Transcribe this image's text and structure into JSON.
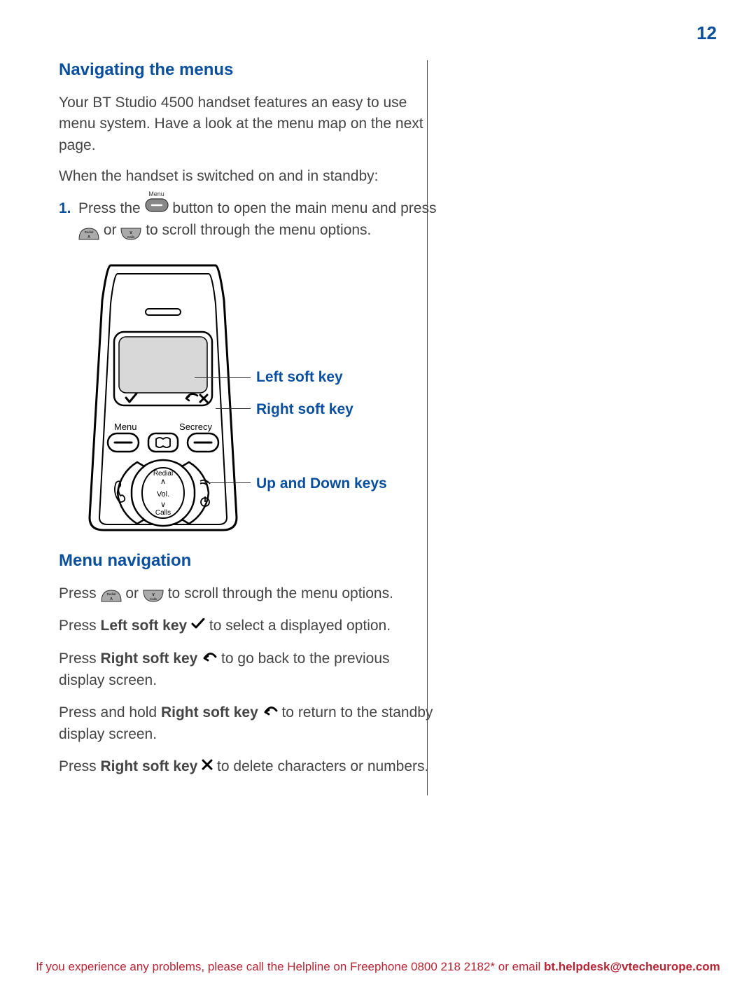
{
  "page_number": "12",
  "section1": {
    "title": "Navigating the menus",
    "intro1": "Your BT Studio 4500 handset features an easy to use menu system. Have a look at the menu map on the next page.",
    "intro2": "When the handset is switched on and in standby:",
    "step1_num": "1.",
    "step1_a": "Press the ",
    "step1_b": " button to open the main menu and press ",
    "step1_c": " or ",
    "step1_d": " to scroll through the menu options.",
    "menu_btn_label": "Menu"
  },
  "callouts": {
    "left_soft": "Left soft key",
    "right_soft": "Right soft key",
    "up_down": "Up and Down keys"
  },
  "phone_labels": {
    "menu": "Menu",
    "secrecy": "Secrecy",
    "redial": "Redial",
    "vol": "Vol.",
    "calls": "Calls"
  },
  "section2": {
    "title": "Menu navigation",
    "line1_a": "Press ",
    "line1_b": " or ",
    "line1_c": " to scroll through the menu options.",
    "line2_a": "Press ",
    "line2_bold": "Left soft key ",
    "line2_b": " to select a displayed option.",
    "line3_a": "Press ",
    "line3_bold": "Right soft key ",
    "line3_b": " to go back to the previous display screen.",
    "line4_a": "Press and hold ",
    "line4_bold": "Right soft key ",
    "line4_b": " to return to the standby display screen.",
    "line5_a": "Press ",
    "line5_bold": "Right soft key ",
    "line5_b": " to delete characters or numbers."
  },
  "footer": {
    "text_a": "If you experience any problems, please call the Helpline on Freephone 0800 218 2182* or email ",
    "text_bold": "bt.helpdesk@vtecheurope.com"
  }
}
